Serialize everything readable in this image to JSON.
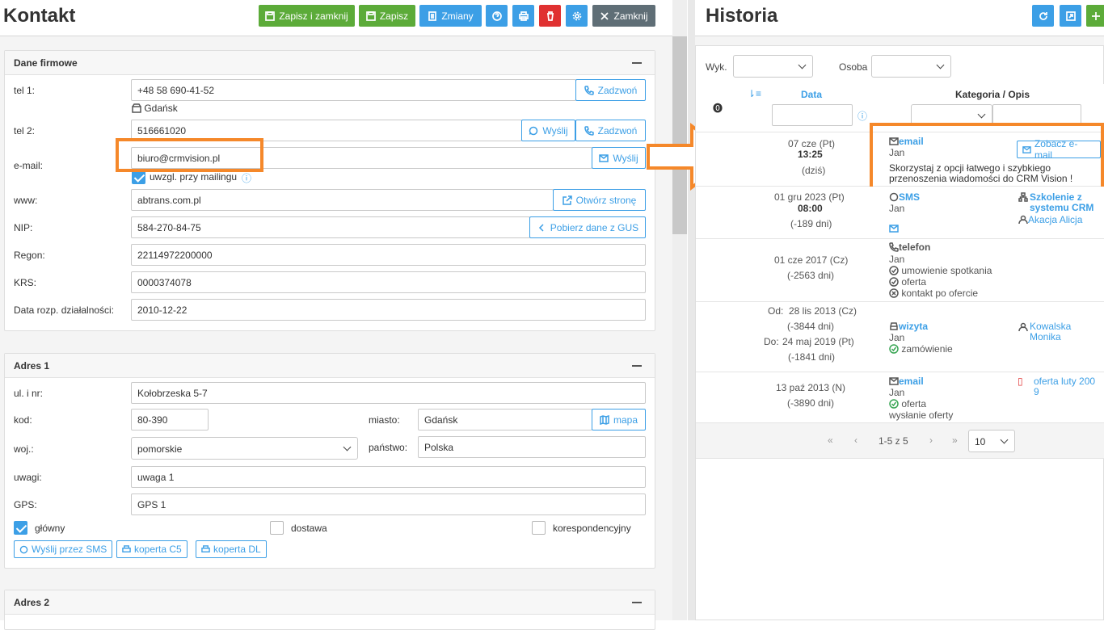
{
  "left": {
    "title": "Kontakt",
    "toolbar": {
      "save_close": "Zapisz i zamknij",
      "save": "Zapisz",
      "changes": "Zmiany",
      "close": "Zamknij"
    }
  },
  "firm": {
    "title": "Dane firmowe",
    "tel1": {
      "label": "tel 1:",
      "value": "+48 58 690-41-52",
      "call": "Zadzwoń",
      "city": "Gdańsk"
    },
    "tel2": {
      "label": "tel 2:",
      "value": "516661020",
      "send": "Wyślij",
      "call": "Zadzwoń"
    },
    "email": {
      "label": "e-mail:",
      "value": "biuro@crmvision.pl",
      "send": "Wyślij",
      "mailing": "uwzgl. przy mailingu"
    },
    "www": {
      "label": "www:",
      "value": "abtrans.com.pl",
      "open": "Otwórz stronę"
    },
    "nip": {
      "label": "NIP:",
      "value": "584-270-84-75",
      "gus": "Pobierz dane z GUS"
    },
    "regon": {
      "label": "Regon:",
      "value": "22114972200000"
    },
    "krs": {
      "label": "KRS:",
      "value": "0000374078"
    },
    "start": {
      "label": "Data rozp. działalności:",
      "value": "2010-12-22"
    }
  },
  "addr1": {
    "title": "Adres 1",
    "street": {
      "label": "ul. i nr:",
      "value": "Kołobrzeska 5-7"
    },
    "code": {
      "label": "kod:",
      "value": "80-390"
    },
    "city": {
      "label": "miasto:",
      "value": "Gdańsk",
      "map": "mapa"
    },
    "voiv": {
      "label": "woj.:",
      "value": "pomorskie"
    },
    "country": {
      "label": "państwo:",
      "value": "Polska"
    },
    "notes": {
      "label": "uwagi:",
      "value": "uwaga 1"
    },
    "gps": {
      "label": "GPS:",
      "value": "GPS 1"
    },
    "checks": {
      "main": "główny",
      "delivery": "dostawa",
      "corr": "korespondencyjny"
    },
    "buttons": {
      "sms": "Wyślij przez SMS",
      "c5": "koperta C5",
      "dl": "koperta DL"
    }
  },
  "addr2": {
    "title": "Adres 2"
  },
  "history": {
    "title": "Historia",
    "filters": {
      "wyk": "Wyk.",
      "osoba": "Osoba"
    },
    "cols": {
      "date": "Data",
      "cat": "Kategoria / Opis"
    },
    "rows": [
      {
        "d1": "07 cze (Pt)",
        "d2": "13:25",
        "d3": "(dziś)",
        "type": "email",
        "who": "Jan",
        "desc1": "Skorzystaj z opcji łatwego i szybkiego",
        "desc2": "przenoszenia wiadomości do CRM Vision !",
        "btn": "Zobacz e-mail"
      },
      {
        "d1": "01 gru 2023 (Pt)",
        "d2": "08:00",
        "d3": "(-189 dni)",
        "type": "SMS",
        "who": "Jan",
        "link1": "Szkolenie z",
        "link2": "systemu CRM",
        "person": "Akacja Alicja"
      },
      {
        "d1": "01 cze 2017 (Cz)",
        "d3": "(-2563 dni)",
        "type": "telefon",
        "who": "Jan",
        "t1": "umowienie spotkania",
        "t2": "oferta",
        "t3": "kontakt po ofercie"
      },
      {
        "od": "Od:",
        "d1": "28 lis 2013 (Cz)",
        "d3": "(-3844 dni)",
        "do": "Do:",
        "d4": "24 maj 2019 (Pt)",
        "d5": "(-1841 dni)",
        "type": "wizyta",
        "who": "Jan",
        "t1": "zamówienie",
        "person1": "Kowalska",
        "person2": "Monika"
      },
      {
        "d1": "13 paź 2013 (N)",
        "d3": "(-3890 dni)",
        "type": "email",
        "who": "Jan",
        "t1": "oferta",
        "t2": "wysłanie oferty",
        "file1": "oferta luty 200",
        "file2": "9"
      }
    ],
    "pager": {
      "info": "1-5 z 5",
      "size": "10"
    }
  }
}
